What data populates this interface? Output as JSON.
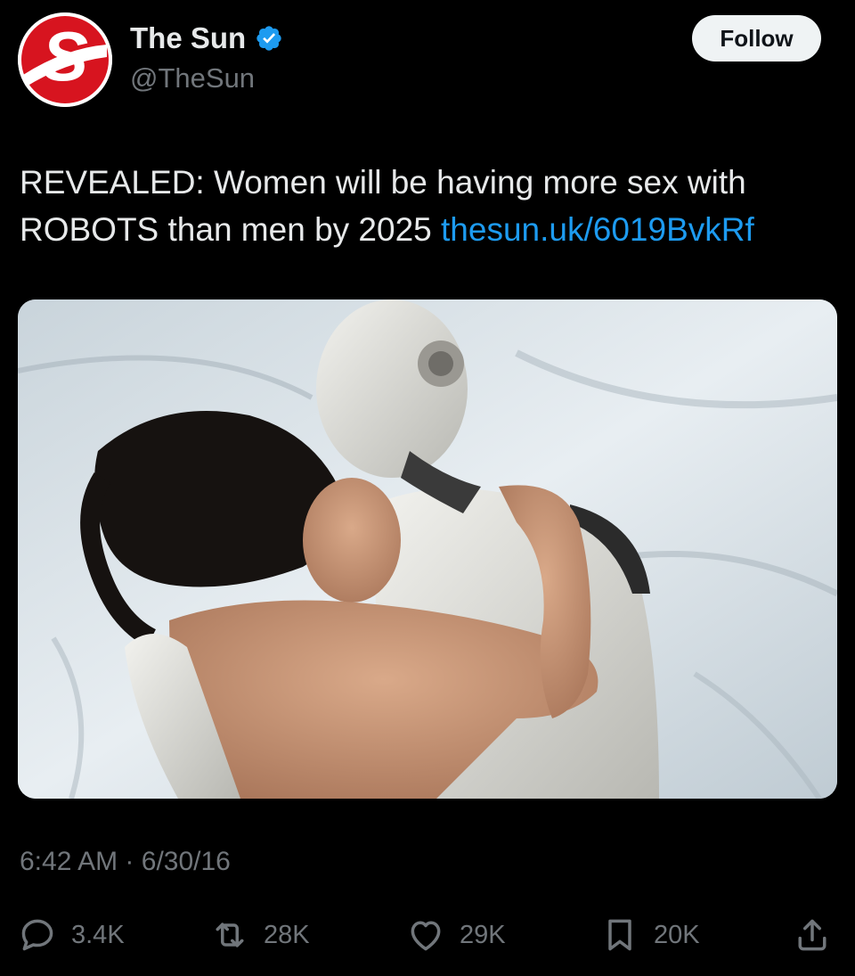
{
  "author": {
    "display_name": "The Sun",
    "handle": "@TheSun",
    "avatar_letter": "S",
    "avatar_color": "#d7141f",
    "verified_color": "#1d9bf0"
  },
  "follow_label": "Follow",
  "tweet": {
    "text": "REVEALED: Women will be having more sex with ROBOTS than men by 2025",
    "link": "thesun.uk/6019BvkRf",
    "link_color": "#1d9bf0"
  },
  "media": {
    "alt": "",
    "icon": "photo-woman-with-robot"
  },
  "timestamp": {
    "time": "6:42 AM",
    "separator": "·",
    "date": "6/30/16"
  },
  "actions": {
    "replies": "3.4K",
    "reposts": "28K",
    "likes": "29K",
    "bookmarks": "20K"
  },
  "colors": {
    "background": "#000000",
    "text": "#e7e9ea",
    "muted": "#71767b"
  }
}
